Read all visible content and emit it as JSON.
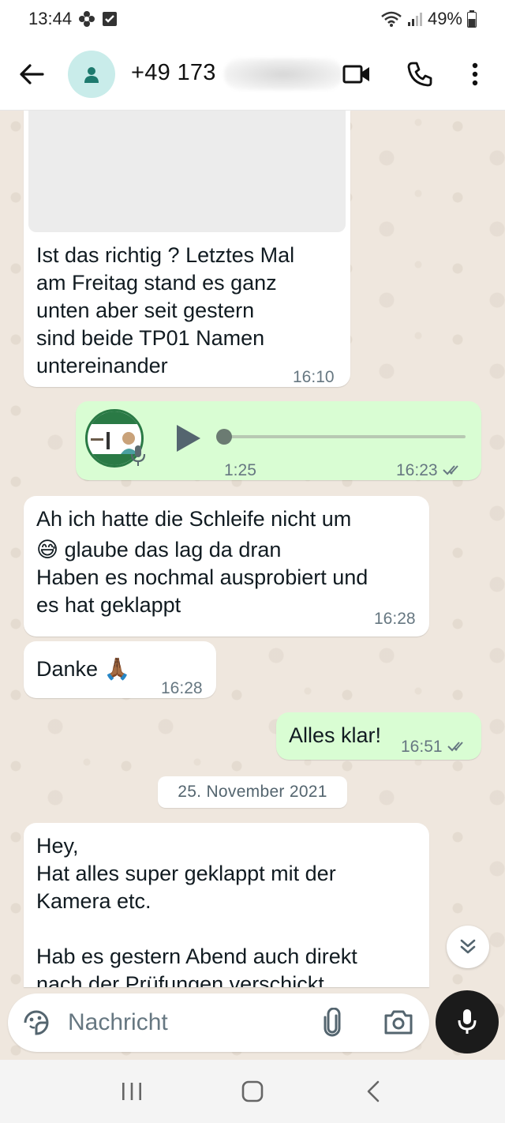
{
  "status_bar": {
    "time": "13:44",
    "battery": "49%",
    "icons": [
      "flower-icon",
      "checkbox-icon",
      "wifi-icon",
      "signal-icon",
      "battery-icon"
    ]
  },
  "header": {
    "contact_name": "+49 173",
    "icons": [
      "back-arrow-icon",
      "avatar-person-icon",
      "video-call-icon",
      "phone-icon",
      "more-vert-icon"
    ]
  },
  "messages": [
    {
      "direction": "in",
      "text_lines": [
        "Ist das richtig ? Letztes Mal",
        "am Freitag stand es ganz",
        "unten aber seit gestern",
        "sind beide TP01 Namen",
        "untereinander"
      ],
      "time": "16:10"
    },
    {
      "direction": "out",
      "type": "voice",
      "duration": "1:25",
      "time": "16:23",
      "status": "read"
    },
    {
      "direction": "in",
      "text_lines": [
        "Ah ich hatte die Schleife nicht um",
        "😅 glaube das lag da dran",
        "Haben es nochmal ausprobiert und",
        "es hat geklappt"
      ],
      "time": "16:28"
    },
    {
      "direction": "in",
      "text": "Danke 🙏🏾",
      "time": "16:28"
    },
    {
      "direction": "out",
      "text": "Alles klar!",
      "time": "16:51",
      "status": "read"
    },
    {
      "direction": "in",
      "text_lines": [
        "Hey,",
        "Hat alles super geklappt mit der",
        "Kamera etc.",
        "",
        "Hab es gestern Abend auch direkt",
        "nach der Prüfungen verschickt"
      ]
    }
  ],
  "date_separator": "25. November 2021",
  "input": {
    "placeholder": "Nachricht"
  },
  "colors": {
    "chat_background": "#efe7de",
    "incoming_bubble": "#ffffff",
    "outgoing_bubble": "#d9fdd3",
    "avatar_bg": "#c9ecea",
    "mic_button": "#1b1b1b"
  }
}
